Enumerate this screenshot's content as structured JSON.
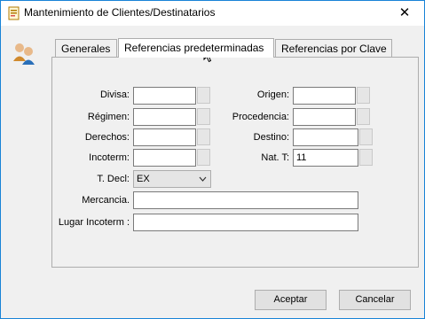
{
  "window": {
    "title": "Mantenimiento de Clientes/Destinatarios",
    "close_glyph": "✕"
  },
  "tabs": [
    {
      "label": "Generales",
      "active": false
    },
    {
      "label": "Referencias predeterminadas",
      "active": true
    },
    {
      "label": "Referencias por Clave",
      "active": false
    }
  ],
  "form": {
    "divisa": {
      "label": "Divisa:",
      "value": ""
    },
    "regimen": {
      "label": "Régimen:",
      "value": ""
    },
    "derechos": {
      "label": "Derechos:",
      "value": ""
    },
    "incoterm": {
      "label": "Incoterm:",
      "value": ""
    },
    "origen": {
      "label": "Origen:",
      "value": ""
    },
    "procedencia": {
      "label": "Procedencia:",
      "value": ""
    },
    "destino": {
      "label": "Destino:",
      "value": ""
    },
    "nat_t": {
      "label": "Nat. T:",
      "value": "11"
    },
    "t_decl": {
      "label": "T. Decl:",
      "value": "EX"
    },
    "mercancia": {
      "label": "Mercancia.",
      "value": ""
    },
    "lugar_incoterm": {
      "label": "Lugar Incoterm :",
      "value": ""
    }
  },
  "buttons": {
    "accept": "Aceptar",
    "cancel": "Cancelar"
  },
  "icons": {
    "title_icon": "form-icon",
    "panel_icon": "users-icon",
    "close": "close-icon",
    "dropdown": "chevron-down-icon"
  }
}
